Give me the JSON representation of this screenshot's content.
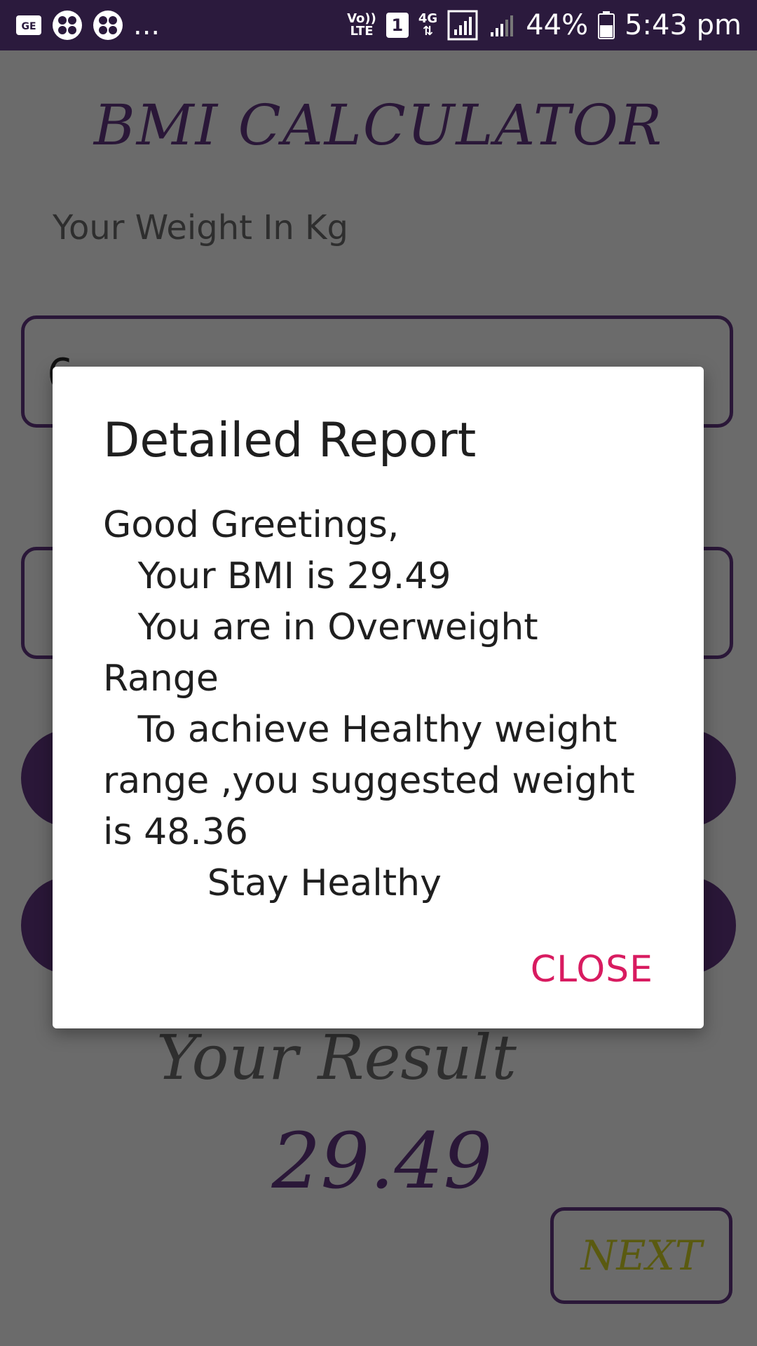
{
  "status_bar": {
    "left_icons": [
      "ge-icon",
      "app-icon",
      "app-icon"
    ],
    "overflow": "...",
    "volte": "Vo))",
    "lte": "LTE",
    "sim": "1",
    "network": "4G",
    "battery_percent": "44%",
    "time": "5:43 pm"
  },
  "app": {
    "title": "BMI CALCULATOR",
    "weight_label": "Your Weight In Kg",
    "weight_value": "6",
    "result_label": "Your Result",
    "result_value": "29.49",
    "next_label": "NEXT"
  },
  "dialog": {
    "title": "Detailed Report",
    "lines": [
      "Good Greetings,",
      "   Your BMI is 29.49",
      "   You are in Overweight",
      "Range",
      "   To achieve Healthy weight",
      "range ,you suggested weight",
      "is 48.36",
      "         Stay Healthy"
    ],
    "close_label": "CLOSE"
  },
  "colors": {
    "status_bar": "#2b1a3d",
    "accent": "#2a1738",
    "close": "#d81b60",
    "overlay": "#6b6b6b"
  }
}
